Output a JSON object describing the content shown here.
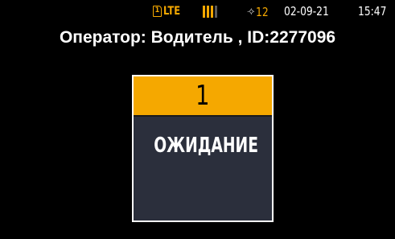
{
  "status_bar": {
    "sim_slot": "1",
    "network": "LTE",
    "signal_bars_total": 4,
    "signal_bars_active": 3,
    "satellite_icon": "satellite-icon",
    "satellites": "12",
    "date": "02-09-21",
    "time": "15:47"
  },
  "header": {
    "operator_text": "Оператор: Водитель , ID:2277096"
  },
  "card": {
    "number": "1",
    "status": "ОЖИДАНИЕ"
  },
  "colors": {
    "background": "#000000",
    "accent": "#f5a800",
    "card_body": "#2b2f3c",
    "text": "#ffffff"
  }
}
